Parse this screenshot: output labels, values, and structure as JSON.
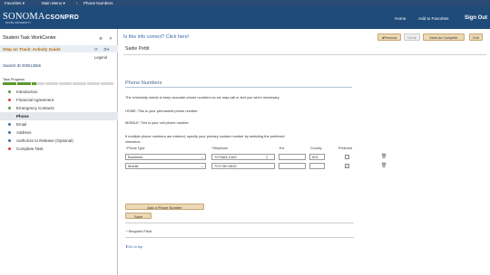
{
  "menubar": {
    "favorites": "Favorites ▾",
    "main_menu": "Main Menu ▾",
    "breadcrumb_sep": "›",
    "breadcrumb": "Phone Numbers"
  },
  "header": {
    "logo_text": "SONOMA",
    "logo_sub": "STATE UNIVERSITY",
    "app_title": "CSONPRD",
    "links": [
      "Home",
      "Add to Favorites",
      "Sign Out"
    ]
  },
  "left_panel": {
    "title": "Student Task WorkCenter",
    "activity_guide": "Step on Track: Activity Guide",
    "legend": "Legend",
    "student_id": "Student ID 005013556",
    "progress_label": "Task Progress",
    "progress_fraction": 0.3,
    "steps": [
      {
        "label": "Introduction",
        "status": "done"
      },
      {
        "label": "Financial Agreement",
        "status": "todo"
      },
      {
        "label": "Emergency Contacts",
        "status": "done"
      },
      {
        "label": "Phone",
        "status": "current"
      },
      {
        "label": "Email",
        "status": "info"
      },
      {
        "label": "Address",
        "status": "info"
      },
      {
        "label": "Authorize to Release (Optional)",
        "status": "info"
      },
      {
        "label": "Complete Task",
        "status": "todo"
      }
    ]
  },
  "main": {
    "question_link": "Is this info correct? Click here!",
    "buttons": {
      "previous": "◂Previous",
      "next": "Next▸",
      "mark_complete": "Mark As Complete",
      "exit": "Exit"
    },
    "student_name": "Sadie Pettit",
    "section_title": "Phone Numbers",
    "instructions": [
      "The University needs to keep accurate phone numbers so we may call or text you when necessary.",
      "HOME: This is your permanent phone number.",
      "MOBILE: This is your cell phone number.",
      "If multiple phone numbers are entered, specify your primary contact number by selecting the preferred",
      "checkbox."
    ],
    "grid_headers": {
      "type": "*Phone Type",
      "telephone": "*Telephone",
      "ext": "Ext",
      "country": "Country",
      "preferred": "Preferred"
    },
    "rows": [
      {
        "type": "Business",
        "telephone": "707/664-2182",
        "ext": "",
        "country": "001",
        "preferred": false
      },
      {
        "type": "Mobile",
        "telephone": "707/780-9532",
        "ext": "",
        "country": "",
        "preferred": true
      }
    ],
    "add_button": "Add a Phone Number",
    "save_button": "Save",
    "required_note": "* Required Field",
    "go_to_top": "Go to top"
  }
}
